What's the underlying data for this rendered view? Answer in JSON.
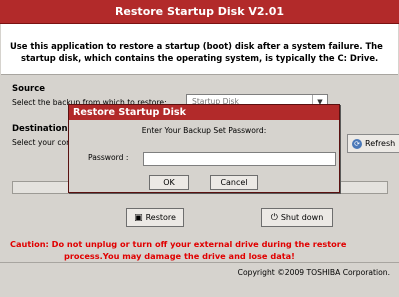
{
  "window": {
    "title": "Restore Startup Disk V2.01"
  },
  "intro": {
    "line1": "Use this application to restore a startup (boot) disk after a system failure. The",
    "line2": "startup disk, which contains the operating system, is typically the C: Drive."
  },
  "source": {
    "title": "Source",
    "desc": "Select the backup from which to restore:",
    "combo_value": "Startup Disk"
  },
  "destination": {
    "title": "Destination",
    "desc": "Select your computer's startup disk",
    "refresh_label": "Refresh"
  },
  "progress": {
    "fraction": 0.0
  },
  "buttons": {
    "restore_label": "Restore",
    "shutdown_label": "Shut down"
  },
  "caution": {
    "line1": "Caution: Do not unplug or turn off your external drive during the restore",
    "line2": "process.You may damage the drive and lose data!"
  },
  "footer": {
    "copyright": "Copyright ©2009 TOSHIBA Corporation."
  },
  "dialog": {
    "title": "Restore Startup Disk",
    "prompt": "Enter Your Backup Set Password:",
    "password_label": "Password :",
    "password_value": "",
    "ok_label": "OK",
    "cancel_label": "Cancel"
  }
}
